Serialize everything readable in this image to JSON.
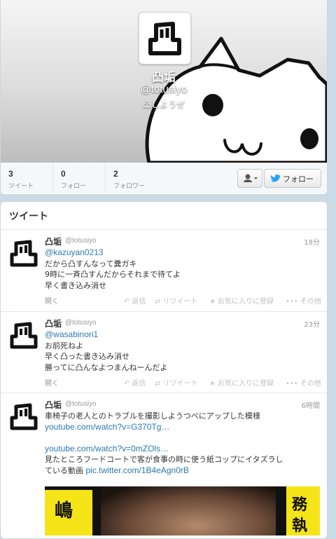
{
  "profile": {
    "name": "凸垢",
    "handle": "@totusiyo",
    "bio": "凸しようぜ",
    "stats": [
      {
        "value": "3",
        "label": "ツイート"
      },
      {
        "value": "0",
        "label": "フォロー"
      },
      {
        "value": "2",
        "label": "フォロワー"
      }
    ],
    "follow_label": "フォロー",
    "user_menu_icon": "user-dropdown-icon",
    "follow_icon": "twitter-bird-icon"
  },
  "timeline": {
    "title": "ツイート",
    "tweets": [
      {
        "name": "凸垢",
        "handle": "@totusiyo",
        "time": "18分",
        "mention": "@kazuyan0213",
        "lines": [
          "だから凸すんなって糞ガキ",
          "9時に一斉凸すんだからそれまで待てよ",
          "早く書き込み消せ"
        ]
      },
      {
        "name": "凸垢",
        "handle": "@totusiyo",
        "time": "23分",
        "mention": "@wasabinori1",
        "lines": [
          "お前死ねよ",
          "早く凸った書き込み消せ",
          "勝ってに凸んなよつまんねーんだよ"
        ]
      },
      {
        "name": "凸垢",
        "handle": "@totusiyo",
        "time": "6時間",
        "line1": "車椅子の老人とのトラブルを撮影しようつべにアップした模様",
        "link1": "youtube.com/watch?v=G370Tg…",
        "link2": "youtube.com/watch?v=0mZOls…",
        "line2": "見たところフードコートで客が食事の時に使う紙コップにイタズラし",
        "line3": "ている動画",
        "link3": "pic.twitter.com/1B4eAgn0rB",
        "media_text": [
          "嶋",
          "務",
          "執"
        ]
      }
    ],
    "actions": {
      "open": "開く",
      "reply": "返信",
      "retweet": "リツイート",
      "favorite": "お気に入りに登録",
      "more": "その他"
    }
  }
}
